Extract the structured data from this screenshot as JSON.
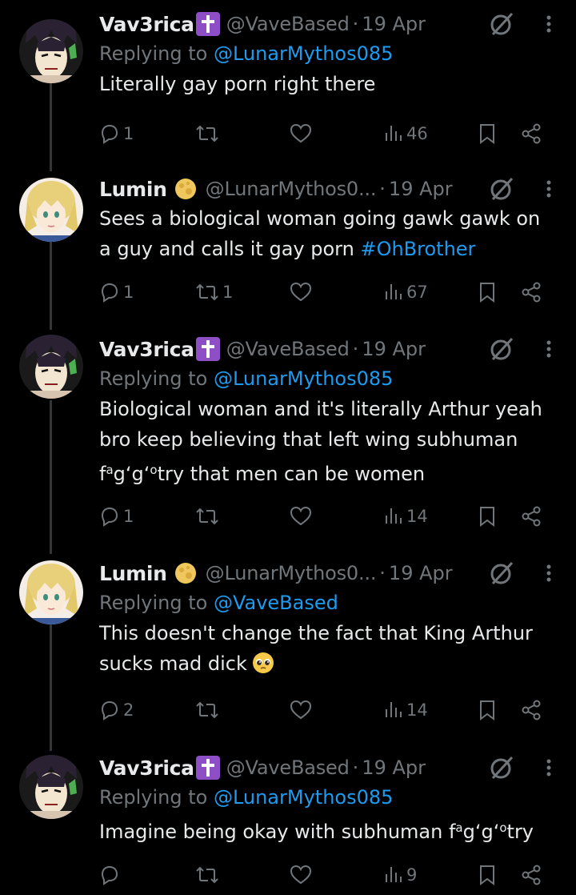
{
  "colors": {
    "background": "#000000",
    "text": "#e7e9ea",
    "muted": "#71767b",
    "link": "#1d9bf0",
    "thread_line": "#333639",
    "badge_purple": "#8e4ec6"
  },
  "tweets": [
    {
      "name": "Vav3rica",
      "badge": "latin-cross-emoji",
      "handle": "@VaveBased",
      "sep": "·",
      "time": "19 Apr",
      "reply_prefix": "Replying to ",
      "reply_to": "@LunarMythos085",
      "body": "Literally gay porn right there",
      "replies": "1",
      "retweets": "",
      "likes": "",
      "views": "46"
    },
    {
      "name": "Lumin",
      "badge": "full-moon-emoji",
      "handle": "@LunarMythos0...",
      "sep": "·",
      "time": "19 Apr",
      "body_pre": "Sees a biological woman going gawk gawk on\na guy and calls it gay porn ",
      "hashtag": "#OhBrother",
      "replies": "1",
      "retweets": "1",
      "likes": "",
      "views": "67"
    },
    {
      "name": "Vav3rica",
      "badge": "latin-cross-emoji",
      "handle": "@VaveBased",
      "sep": "·",
      "time": "19 Apr",
      "reply_prefix": "Replying to ",
      "reply_to": "@LunarMythos085",
      "body_line1": "Biological woman and it's literally Arthur yeah",
      "body_line2": "bro keep believing that left wing subhuman",
      "body_line3_f": "f",
      "body_line3_sup1": "a",
      "body_line3_g1": "g‘g‘",
      "body_line3_sup2": "o",
      "body_line3_rest": "try that men can be women",
      "replies": "1",
      "retweets": "",
      "likes": "",
      "views": "14"
    },
    {
      "name": "Lumin",
      "badge": "full-moon-emoji",
      "handle": "@LunarMythos0...",
      "sep": "·",
      "time": "19 Apr",
      "reply_prefix": "Replying to ",
      "reply_to": "@VaveBased",
      "body": "This doesn't change the fact that King Arthur\nsucks mad dick",
      "body_emoji": "pleading-face-emoji",
      "replies": "2",
      "retweets": "",
      "likes": "",
      "views": "14"
    },
    {
      "name": "Vav3rica",
      "badge": "latin-cross-emoji",
      "handle": "@VaveBased",
      "sep": "·",
      "time": "19 Apr",
      "reply_prefix": "Replying to ",
      "reply_to": "@LunarMythos085",
      "body_pre": "Imagine being okay with subhuman f",
      "body_sup1": "a",
      "body_mid": "g‘g‘",
      "body_sup2": "o",
      "body_end": "try",
      "replies": "",
      "retweets": "",
      "likes": "",
      "views": "9"
    }
  ]
}
